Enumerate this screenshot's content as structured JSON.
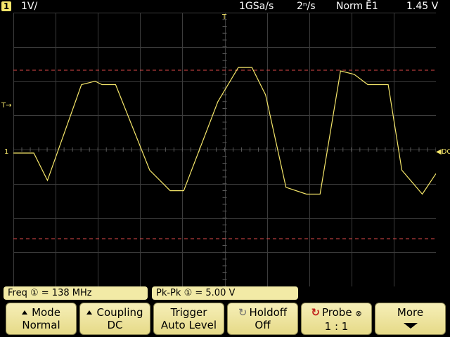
{
  "status": {
    "channel_number": "1",
    "channel_scale": "1V/",
    "sample_rate": "1GSa/s",
    "timebase": "2ⁿ/s",
    "trigger_mode": "Norm",
    "trigger_source": "Ē1",
    "trigger_level": "1.45 V"
  },
  "markers": {
    "trigger_top": "T",
    "trigger_level_left": "T→",
    "channel_ground": "1",
    "dc_right": "◀DC"
  },
  "measurements": {
    "freq_label": "Freq",
    "freq_channel": "①",
    "freq_value": "= 138 MHz",
    "pkpk_label": "Pk-Pk",
    "pkpk_channel": "①",
    "pkpk_value": "=  5.00  V"
  },
  "softkeys": {
    "mode": {
      "label": "Mode",
      "value": "Normal"
    },
    "coupling": {
      "label": "Coupling",
      "value": "DC"
    },
    "trigger": {
      "label": "Trigger",
      "value": "Auto Level"
    },
    "holdoff": {
      "label": "Holdoff",
      "value": "Off"
    },
    "probe": {
      "label": "Probe",
      "value": "1 : 1",
      "badge": "⊗"
    },
    "more": {
      "label": "More"
    }
  },
  "colors": {
    "trace": "#f5e66a",
    "grid": "#3c3c3c",
    "cursor": "#e04a4a",
    "softkey_bg": "#f2eaa6"
  },
  "waveform": {
    "unit": "V",
    "points": [
      [
        0,
        0.0
      ],
      [
        30,
        0.0
      ],
      [
        50,
        -0.8
      ],
      [
        100,
        2.0
      ],
      [
        120,
        2.1
      ],
      [
        130,
        2.0
      ],
      [
        150,
        2.0
      ],
      [
        200,
        -0.5
      ],
      [
        230,
        -1.1
      ],
      [
        250,
        -1.1
      ],
      [
        300,
        1.5
      ],
      [
        330,
        2.5
      ],
      [
        350,
        2.5
      ],
      [
        370,
        1.7
      ],
      [
        400,
        -1.0
      ],
      [
        430,
        -1.2
      ],
      [
        450,
        -1.2
      ],
      [
        480,
        2.4
      ],
      [
        500,
        2.3
      ],
      [
        520,
        2.0
      ],
      [
        550,
        2.0
      ],
      [
        570,
        -0.5
      ],
      [
        600,
        -1.2
      ],
      [
        620,
        -0.6
      ]
    ]
  }
}
